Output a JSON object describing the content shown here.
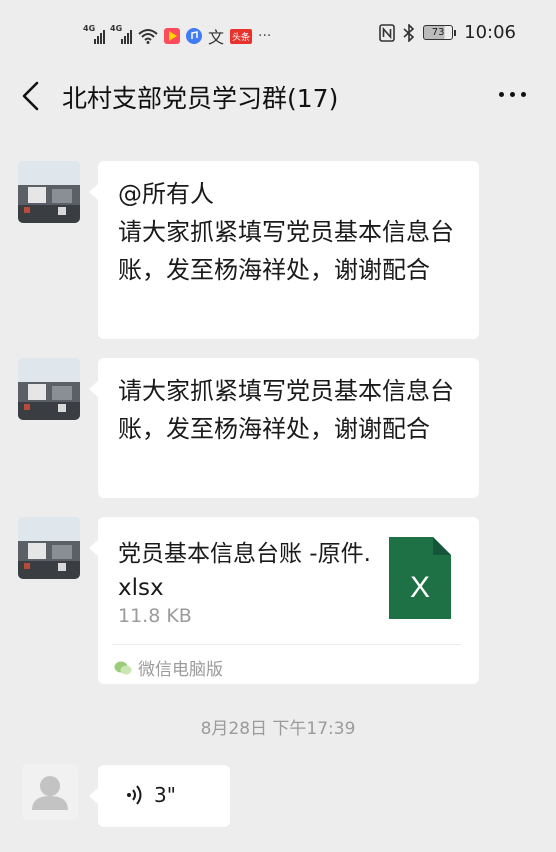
{
  "status_bar": {
    "network_1": "4G",
    "network_2": "4G",
    "app_text_1": "文",
    "app_badge": "头条",
    "battery": "73",
    "more_dots": "···",
    "time": "10:06"
  },
  "header": {
    "title": "北村支部党员学习群(17)"
  },
  "messages": [
    {
      "type": "text",
      "text": "@所有人\n请大家抓紧填写党员基本信息台账，发至杨海祥处，谢谢配合"
    },
    {
      "type": "text",
      "text": "请大家抓紧填写党员基本信息台账，发至杨海祥处，谢谢配合"
    },
    {
      "type": "file",
      "file_name": "党员基本信息台账 -原件.xlsx",
      "file_size": "11.8 KB",
      "file_icon_letter": "X",
      "source": "微信电脑版"
    }
  ],
  "timestamp": "8月28日 下午17:39",
  "voice_message": {
    "duration": "3\""
  },
  "colors": {
    "background": "#ededed",
    "bubble": "#ffffff",
    "excel_green": "#1e7145",
    "meta_gray": "#9b9b9b"
  },
  "icons": [
    "back-chevron-icon",
    "more-dots-icon",
    "signal-icon",
    "wifi-icon",
    "nfc-icon",
    "bluetooth-icon",
    "battery-icon",
    "excel-file-icon",
    "wechat-pc-icon",
    "voice-wave-icon",
    "default-avatar-icon"
  ]
}
